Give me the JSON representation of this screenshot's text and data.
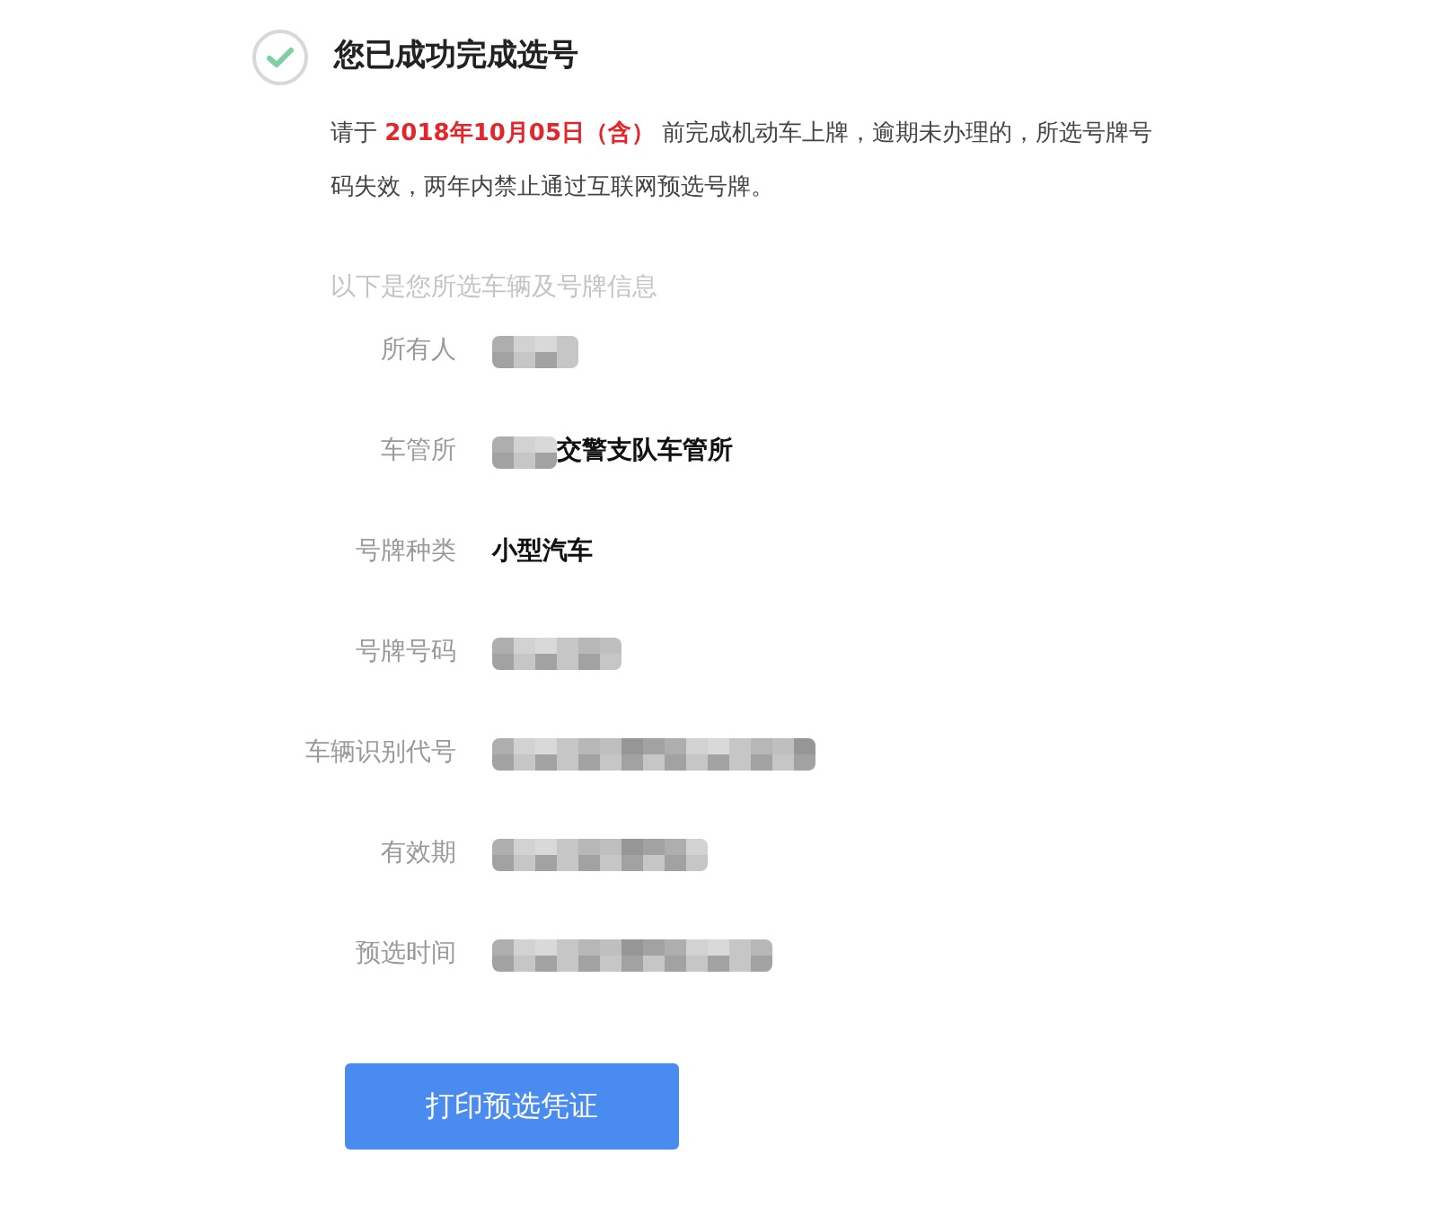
{
  "header": {
    "title": "您已成功完成选号",
    "done": true
  },
  "notice": "请于 **2018年10月05日（含）** 前完成机动车上牌，逾期未办理的，所选号牌号码失效，两年内禁止通过互联网预选号牌。",
  "info_heading": "以下是您所选车辆及号牌信息",
  "rows": [
    {
      "label": "所有人",
      "kind": "blurred"
    },
    {
      "label": "车管所",
      "kind": "partly_blurred",
      "value": "交警支队车管所"
    },
    {
      "label": "号牌种类",
      "kind": "plain",
      "value": "小型汽车"
    },
    {
      "label": "号牌号码",
      "kind": "blurred"
    },
    {
      "label": "车辆识别代号",
      "kind": "blurred"
    },
    {
      "label": "有效期",
      "kind": "blurred"
    },
    {
      "label": "预选时间",
      "kind": "blurred"
    }
  ],
  "print_button": "打印预选凭证"
}
